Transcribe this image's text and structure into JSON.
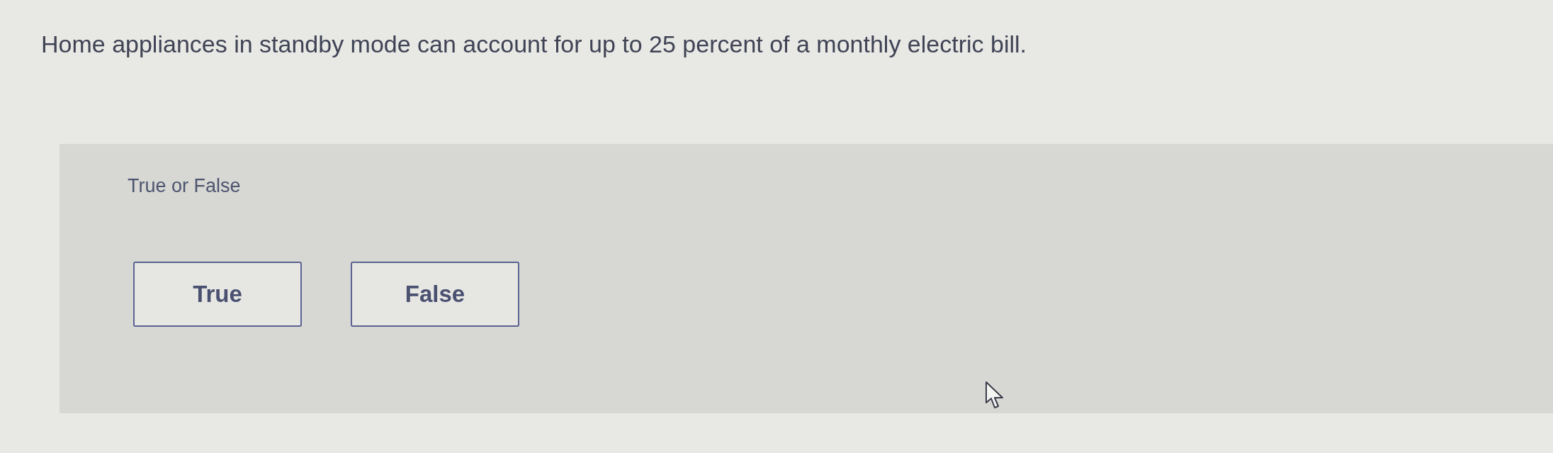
{
  "question": {
    "text": "Home appliances in standby mode can account for up to 25 percent of a monthly electric bill."
  },
  "answer_panel": {
    "prompt": "True or False",
    "options": [
      {
        "label": "True",
        "selected": false
      },
      {
        "label": "False",
        "selected": false
      }
    ]
  }
}
